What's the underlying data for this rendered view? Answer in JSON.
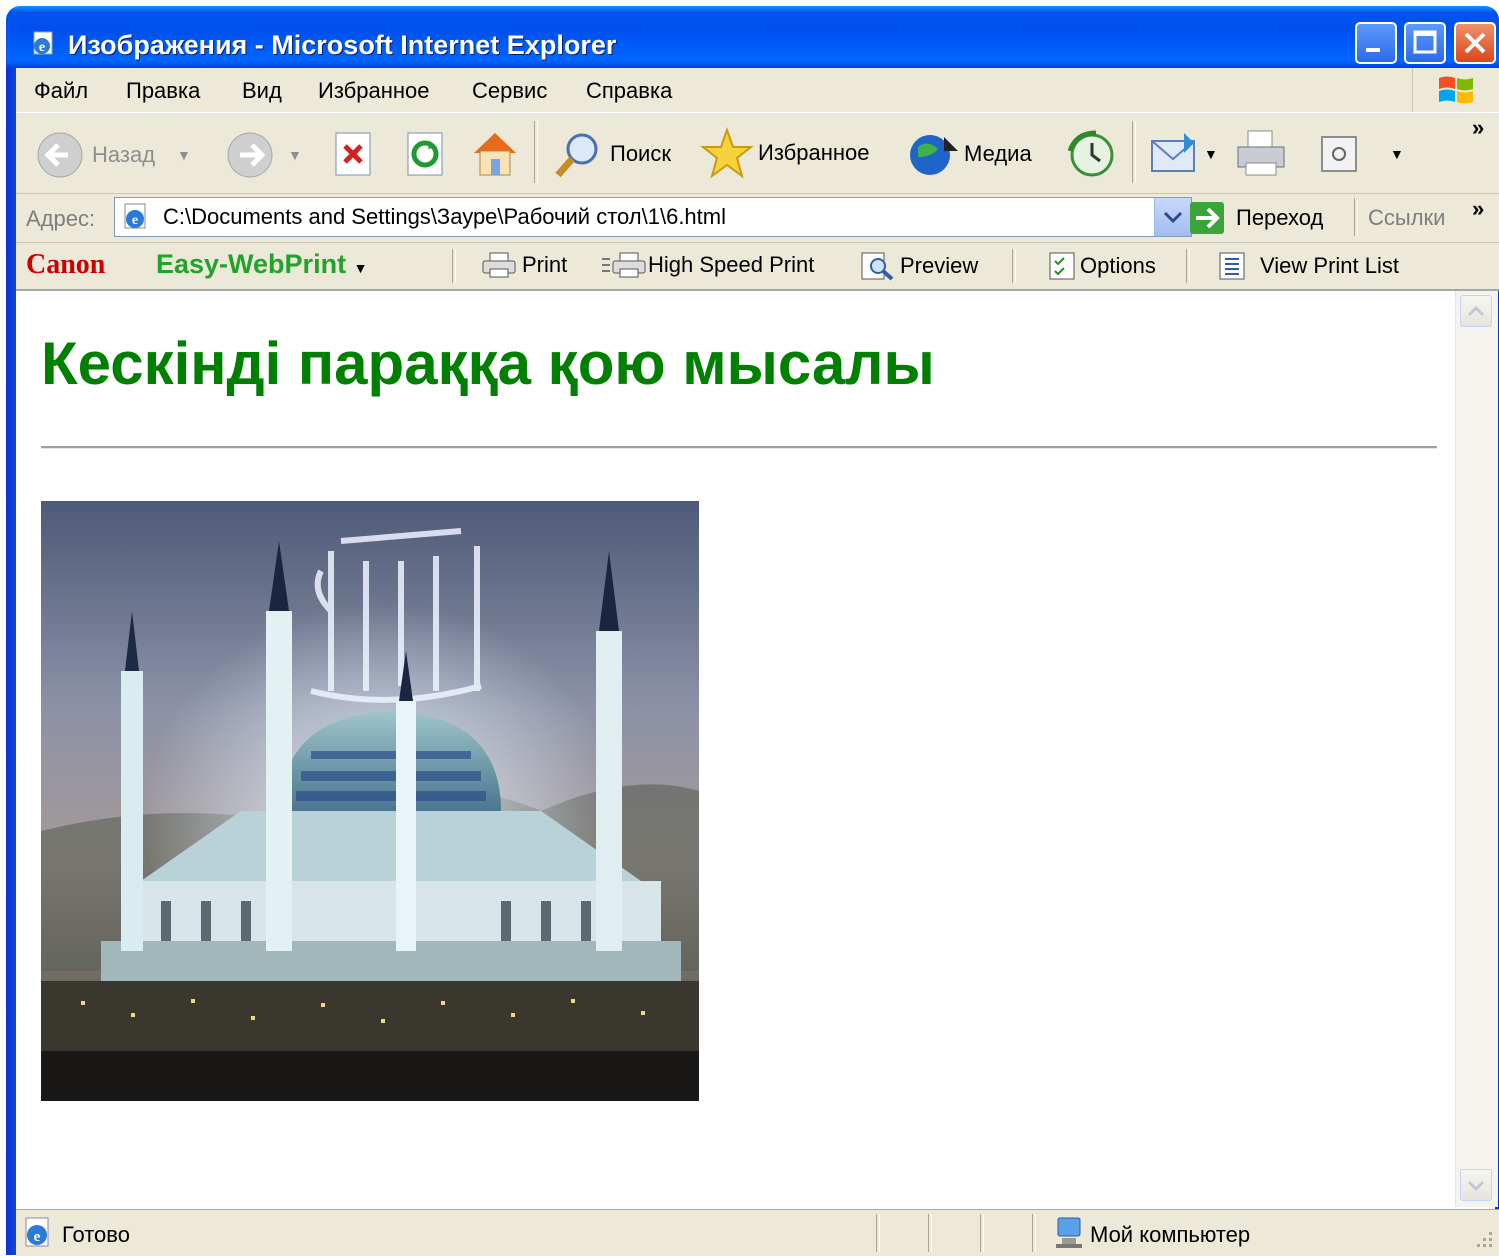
{
  "window": {
    "title": "Изображения - Microsoft Internet Explorer",
    "accent": "#0053ee"
  },
  "menubar": {
    "items": [
      "Файл",
      "Правка",
      "Вид",
      "Избранное",
      "Сервис",
      "Справка"
    ]
  },
  "toolbar": {
    "back_label": "Назад",
    "search_label": "Поиск",
    "favorites_label": "Избранное",
    "media_label": "Медиа"
  },
  "addressbar": {
    "label": "Адрес:",
    "value": "C:\\Documents and Settings\\Заурe\\Рабочий стол\\1\\6.html",
    "go_label": "Переход",
    "links_label": "Ссылки"
  },
  "canonbar": {
    "brand": "Canon",
    "product": "Easy-WebPrint",
    "print_label": "Print",
    "high_speed_label": "High Speed Print",
    "preview_label": "Preview",
    "options_label": "Options",
    "view_list_label": "View Print List"
  },
  "page": {
    "heading": "Кескінді параққа қою мысалы",
    "heading_color": "#008000"
  },
  "statusbar": {
    "status": "Готово",
    "zone": "Мой компьютер"
  }
}
